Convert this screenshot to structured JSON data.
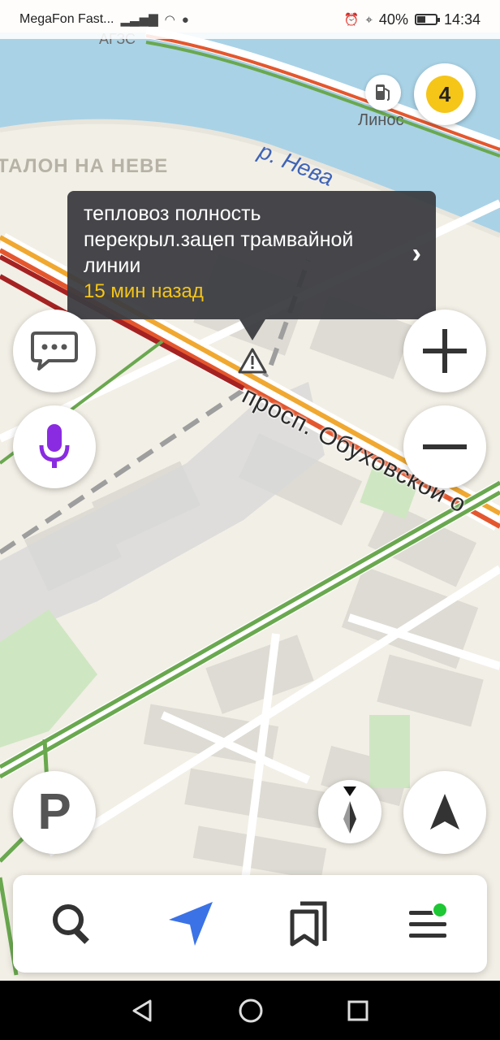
{
  "status_bar": {
    "carrier": "MegaFon Fast...",
    "battery": "40%",
    "battery_level": 0.4,
    "time": "14:34"
  },
  "map": {
    "labels": {
      "gas_station": "АГЗС",
      "linos": "Линос",
      "river": "р. Нева",
      "complex": "ТАЛОН НА НЕВЕ",
      "avenue": "просп. Обуховской о"
    },
    "traffic_level": "4",
    "traffic_color": "#f5c518"
  },
  "incident_tooltip": {
    "text": "тепловоз полность перекрыл.зацеп трамвайной линии",
    "time": "15 мин назад",
    "time_color": "#f5c518"
  },
  "controls": {
    "chat": "chat-bubble-icon",
    "voice": "microphone-icon",
    "zoom_in": "plus-icon",
    "zoom_out": "minus-icon",
    "parking": "P",
    "compass": "compass-icon",
    "location": "navigation-arrow-icon"
  },
  "bottom_bar": {
    "items": [
      "search-icon",
      "route-arrow-icon",
      "bookmarks-icon",
      "menu-icon"
    ],
    "accent_color": "#3b72e6",
    "notification_color": "#1ec734"
  }
}
